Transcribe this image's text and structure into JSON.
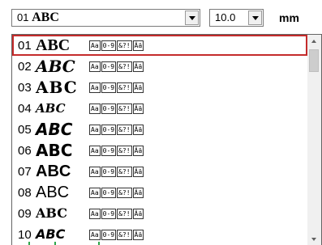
{
  "toolbar": {
    "font_combo_value": "01 ABC",
    "size_combo_value": "10.0",
    "unit": "mm"
  },
  "fonts": [
    {
      "number": "01",
      "sample": "ABC",
      "glyph_boxes": [
        "Aa",
        "0-9",
        "&?!",
        "Ää"
      ]
    },
    {
      "number": "02",
      "sample": "ABC",
      "glyph_boxes": [
        "Aa",
        "0-9",
        "&?!",
        "Ää"
      ]
    },
    {
      "number": "03",
      "sample": "ABC",
      "glyph_boxes": [
        "Aa",
        "0-9",
        "&?!",
        "Ää"
      ]
    },
    {
      "number": "04",
      "sample": "ABC",
      "glyph_boxes": [
        "Aa",
        "0-9",
        "&?!",
        "Ää"
      ]
    },
    {
      "number": "05",
      "sample": "ABC",
      "glyph_boxes": [
        "Aa",
        "0-9",
        "&?!",
        "Ää"
      ]
    },
    {
      "number": "06",
      "sample": "ABC",
      "glyph_boxes": [
        "Aa",
        "0-9",
        "&?!",
        "Ää"
      ]
    },
    {
      "number": "07",
      "sample": "ABC",
      "glyph_boxes": [
        "Aa",
        "0-9",
        "&?!",
        "Ää"
      ]
    },
    {
      "number": "08",
      "sample": "ABC",
      "glyph_boxes": [
        "Aa",
        "0-9",
        "&?!",
        "Ää"
      ]
    },
    {
      "number": "09",
      "sample": "ABC",
      "glyph_boxes": [
        "Aa",
        "0-9",
        "&?!",
        "Ää"
      ]
    },
    {
      "number": "10",
      "sample": "ABC",
      "glyph_boxes": [
        "Aa",
        "0-9",
        "&?!",
        "Ää"
      ]
    }
  ],
  "colors": {
    "selection_border": "#c42b2b",
    "accent_ticks": "#2ea64a"
  },
  "selected_index": 0
}
